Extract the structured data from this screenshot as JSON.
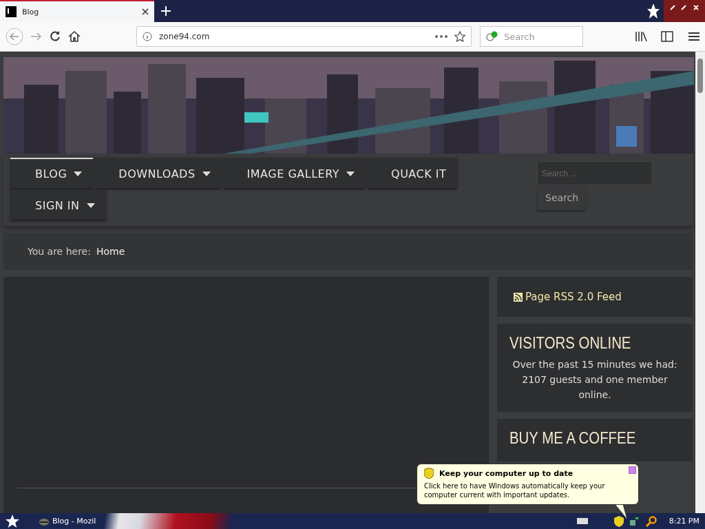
{
  "browser": {
    "tab": {
      "title": "Blog"
    },
    "address": "zone94.com",
    "search_placeholder": "Search"
  },
  "site": {
    "menu": [
      {
        "label": "BLOG",
        "selected": true,
        "has_dropdown": true
      },
      {
        "label": "DOWNLOADS",
        "selected": false,
        "has_dropdown": true
      },
      {
        "label": "IMAGE GALLERY",
        "selected": false,
        "has_dropdown": true
      },
      {
        "label": "QUACK IT",
        "selected": false,
        "has_dropdown": false
      },
      {
        "label": "SIGN IN",
        "selected": false,
        "has_dropdown": true
      }
    ],
    "search": {
      "placeholder": "Search ...",
      "button": "Search"
    },
    "breadcrumb": {
      "label": "You are here:",
      "current": "Home"
    },
    "sidebar": [
      {
        "kind": "link",
        "text": "Page RSS 2.0 Feed"
      },
      {
        "kind": "module",
        "title": "VISITORS ONLINE",
        "text": "Over the past 15 minutes we had: 2107 guests and one member online."
      },
      {
        "kind": "module",
        "title": "BUY ME A COFFEE"
      }
    ]
  },
  "notification": {
    "title": "Keep your computer up to date",
    "text": "Click here to have Windows automatically keep your computer current with important updates."
  },
  "taskbar": {
    "window_button": "Blog - Mozil",
    "clock": "8:21 PM"
  }
}
